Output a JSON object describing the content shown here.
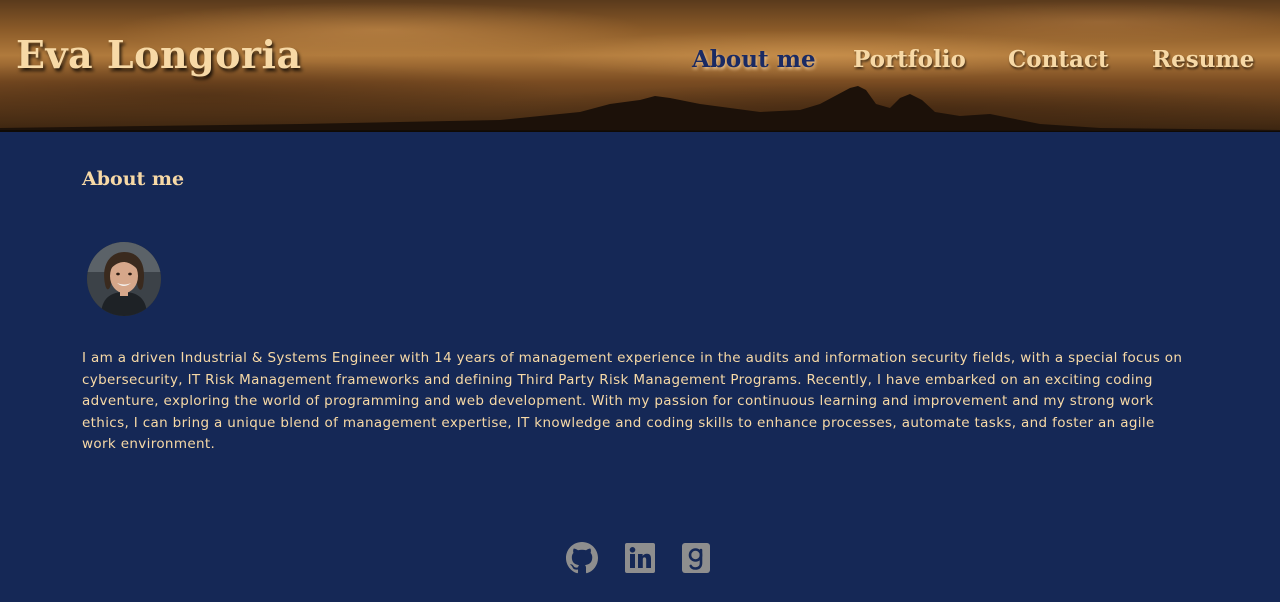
{
  "header": {
    "brand": "Eva Longoria",
    "nav": [
      {
        "label": "About me",
        "active": true
      },
      {
        "label": "Portfolio",
        "active": false
      },
      {
        "label": "Contact",
        "active": false
      },
      {
        "label": "Resume",
        "active": false
      }
    ]
  },
  "main": {
    "section_title": "About me",
    "avatar_icon": "profile-photo",
    "bio": "I am a driven Industrial & Systems Engineer with 14 years of management experience in the audits and information security fields, with a special focus on cybersecurity, IT Risk Management frameworks and defining Third Party Risk Management Programs. Recently, I have embarked on an exciting coding adventure, exploring the world of programming and web development. With my passion for continuous learning and improvement and my strong work ethics, I can bring a unique blend of management expertise, IT knowledge and coding skills to enhance processes, automate tasks, and foster an agile work environment."
  },
  "footer": {
    "social_icons": [
      "github-icon",
      "linkedin-icon",
      "gmail-icon"
    ]
  },
  "colors": {
    "background": "#152856",
    "text_accent": "#f7d9a6",
    "nav_active": "#1a2a63",
    "icon_gray": "#8e8e8e"
  }
}
